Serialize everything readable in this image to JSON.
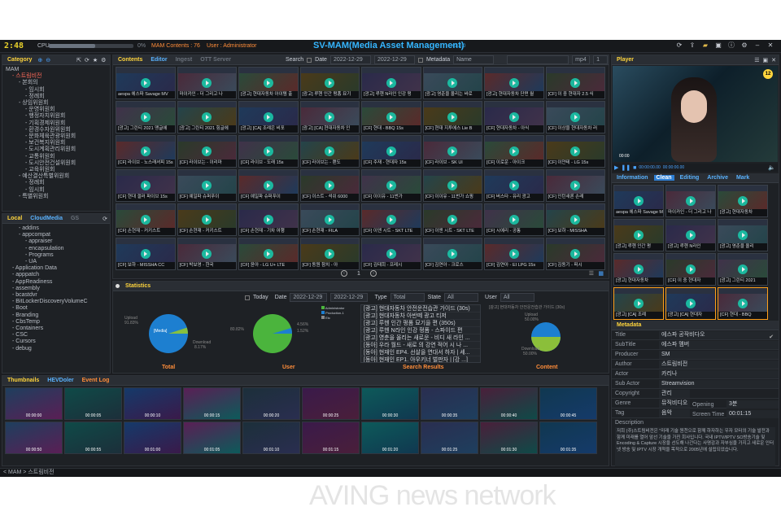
{
  "topbar": {
    "clock": "2:48",
    "cpu_label": "CPU",
    "cpu_level": 0.55,
    "cpu_pct": "0%",
    "mam_contents": "MAM Contents : 76",
    "user": "User : Administrator",
    "title": "SV-MAM(Media Asset Management)",
    "version": "v1.0.0"
  },
  "category": {
    "tab": "Category",
    "items": [
      "MAM",
      "- 스트림비전",
      "- 본회의",
      "- 임시회",
      "- 정례회",
      "- 상임위원회",
      "- 운영위원회",
      "- 행정자치위원회",
      "- 기획경제위원회",
      "- 환경수자원위원회",
      "- 문화체육관광위원회",
      "- 보건복지위원회",
      "- 도시계획관리위원회",
      "- 교통위원회",
      "- 도시안전건설위원회",
      "- 교육위원회",
      "- 예산결산특별위원회",
      "- 정례회",
      "- 임시회",
      "- 특별위원회"
    ]
  },
  "local": {
    "tabs": [
      "Local",
      "CloudMedia",
      "GS"
    ],
    "items": [
      "- addins",
      "- appcompat",
      "- appraiser",
      "- encapsulation",
      "- Programs",
      "- UA",
      "- Application Data",
      "- apppatch",
      "- AppReadiness",
      "- assembly",
      "- bcastdvr",
      "- BitLockerDiscoveryVolumeC",
      "- Boot",
      "- Branding",
      "- CbsTemp",
      "- Containers",
      "- CSC",
      "- Cursors",
      "- debug"
    ]
  },
  "contents": {
    "tabs": [
      "Contents",
      "Editor",
      "Ingest",
      "OTT Server"
    ],
    "search_label": "Search",
    "date_label": "Date",
    "date_from": "2022-12-29",
    "date_to": "2022-12-29",
    "metadata_label": "Metadata",
    "metadata_value": "Name",
    "format": "mp4",
    "page": "1",
    "tiles": [
      "aespa 에스파 Savage MV",
      "마이카인 - 더 그리고 나",
      "[광고] 현대자동차 아이템 출",
      "[광고] 루헨 인간 펑폼 묘기",
      "[광고] 루헨 N라인 인강 펑",
      "[광고] 영춘을 올리는 바로",
      "[광고] 현대자동차 단펀 월",
      "[CF] 이 중 현대자 2.5 식",
      "[광고] 그린티 2021 맹글에",
      "[광고] 그린티 2021 힘글에",
      "[광고] [CA] 조례은 비포",
      "[광고] [CA] 현대자동차 인",
      "[CF] 현대 - BBQ 15s",
      "[CF] 현대 지투에스 Lie B",
      "[CF] 현대자동차 - 아식",
      "[CF] 이상을 현대자동차 러",
      "[CF] 라이브 - 노스래셔피 15s",
      "[CF] 라이브는 - 이리마",
      "[CF] 라이브 - 도래 15s",
      "[CF] 라이브는 - 랜도",
      "[CF] 주재 - 현대자 15s",
      "[CF] 라이브 - SK Ul",
      "[CF] 이로운 - 아이크",
      "[CF] 이얀테 - LG 15s",
      "[CF] 현대 갤러 파이브 15s",
      "[CF] 예일파 슈퍼푸이",
      "[CF] 예일파 슈퍼푸이",
      "[CF] 이스트 - 석쉬 6000",
      "[CF] 이이유 - 11번가",
      "[CF] 이이유 - 11번가 쇼핑",
      "[CF] 버스타 - 유리 광고",
      "[CF] 인턴새론 손레",
      "[CF] 손현재 - 커키스트",
      "[CF] 손현재 - 커키스트",
      "[CF] 손현재 - 기차 여행",
      "[CF] 손현재 - FILA",
      "[CF] 이앤 시트 - SKT LTE",
      "[CF] 이앤 시트 - SKT LTE",
      "[CF] 시예리 - 공통",
      "[CF] 보하 - MISSHA",
      "[CF] 보하 - MISSHA CC",
      "[CF] 박보영 - 한국",
      "[CF] 윤아 - LG U+ LTE",
      "[CF] 동원 참치 - 아",
      "[CF] 김태희 - 프레시",
      "[CF] 김연아 - 크로스",
      "[CF] 김연아 - EI LPG 15s",
      "[CF] 김동기 - 퍼시"
    ]
  },
  "player": {
    "tab": "Player",
    "badge": "12",
    "time_start": "00:00:00.00",
    "time_end": "00:00:00.00",
    "timecode_label": "00:00"
  },
  "player_tabs": [
    "Information",
    "Clean",
    "Editing",
    "Archive",
    "Mark"
  ],
  "info_tiles": [
    "aespa 에스파 Savage MV",
    "마이카인 - 더 그리고 나",
    "[광고] 현대자동차",
    "[광고] 루헨 인간 펑",
    "[광고] 루헨 N라인",
    "[광고] 영춘을 올리",
    "[광고] 현대자동차",
    "[CF] 이 중 현대자",
    "[광고] 그린티 2021",
    "[광고] [CA] 조례",
    "[광고] [CA] 현대자",
    "[CF] 현대 - BBQ"
  ],
  "metadata": {
    "title": "Metadata",
    "rows": [
      [
        "Title",
        "에스파 공작비다오"
      ],
      [
        "SubTitle",
        "에스파 멤버"
      ],
      [
        "Producer",
        "SM"
      ],
      [
        "Author",
        "스트림비전"
      ],
      [
        "Actor",
        "카리나"
      ],
      [
        "Sub Actor",
        "Streamvision"
      ],
      [
        "Copyright",
        "관리"
      ],
      [
        "Genre",
        "뮤직비디오"
      ],
      [
        "Tag",
        "음악"
      ]
    ],
    "opening_label": "Opening",
    "opening_value": "3분",
    "screen_time_label": "Screen Time",
    "screen_time_value": "00:01:15",
    "description_label": "Description",
    "description": "저희 (주)스트림비전은 \"미래 기술 원천으로 함께 하자하는 우자 모터의 기술 발전과 함께 미래를 열어 앞선 기술을 가진 회사입니다. 국내 IPTV/IPTV SO방송기술 및 Encoding & Capture 시장을 선도해 나간다는 사명감과 자부심을 가지고 새로운 인터넷 방송 및 IPTV 시장 개척을 목적으로 2005년에 설립되었습니다."
  },
  "statistics": {
    "tab": "Statistics",
    "today": "Today",
    "date_label": "Date",
    "date_from": "2022-12-29",
    "date_to": "2022-12-29",
    "type_label": "Type",
    "type_value": "Total",
    "state_label": "State",
    "state_value": "All",
    "user_label": "User",
    "user_value": "All",
    "total": {
      "label": "Total",
      "upload": "Upload",
      "upload_pct": "91.83%",
      "download": "Download",
      "download_pct": "8.17%",
      "center": "[Media]"
    },
    "user": {
      "label": "User",
      "pct_a": "80.82%",
      "pct_b": "4.56%",
      "pct_c": "1.52%",
      "legend": [
        "Administrator",
        "Production-1",
        "Etc"
      ]
    },
    "search": {
      "label": "Search Results",
      "rows": [
        "[광고] 현대자동차 안전운전습관 가이드 (30s)",
        "[광고] 현대자동차 아반떼 광고 티저",
        "[광고] 루헨 인간 펑폼 묘기을 편 (350s)",
        "[광고] 루헨 N라인 인강 펑폼 - 스파이드 편",
        "[광고] 영춘을 올리는 새로운 - 비디 새 라인 ...",
        "[동아] 우라 월드 - 새로 의 강연 적어 시 나 ...",
        "[동아] 현재인 EP4. 선살을 연대서 하자 | 세...",
        "[동아] 현재인 EP1. 아우키너 벌판자 | [강 ...]"
      ]
    },
    "content": {
      "label": "Content",
      "head": "[광고] 현대자동차 안전운전습관 가이드 (30s)",
      "upload": "Upload",
      "upload_pct": "50.00%",
      "download": "Download",
      "download_pct": "50.00%"
    }
  },
  "thumbs": {
    "tabs": [
      "Thumbnails",
      "HEVDoler",
      "Event Log"
    ],
    "frames": [
      "00:00:00",
      "00:00:05",
      "00:00:10",
      "00:00:15",
      "00:00:20",
      "00:00:25",
      "00:00:30",
      "00:00:35",
      "00:00:40",
      "00:00:45",
      "00:00:50",
      "00:00:55",
      "00:01:00",
      "00:01:05",
      "00:01:10",
      "00:01:15",
      "00:01:20",
      "00:01:25",
      "00:01:30",
      "00:01:35"
    ]
  },
  "status": {
    "path": "< MAM > 스트림비전"
  },
  "watermark": "AVING news network",
  "colors": {
    "accent": "#ffd53d",
    "brand": "#35b6ff",
    "orange": "#ff8d3a",
    "play": "#19c6a9",
    "selected": "#ff6b5a"
  }
}
